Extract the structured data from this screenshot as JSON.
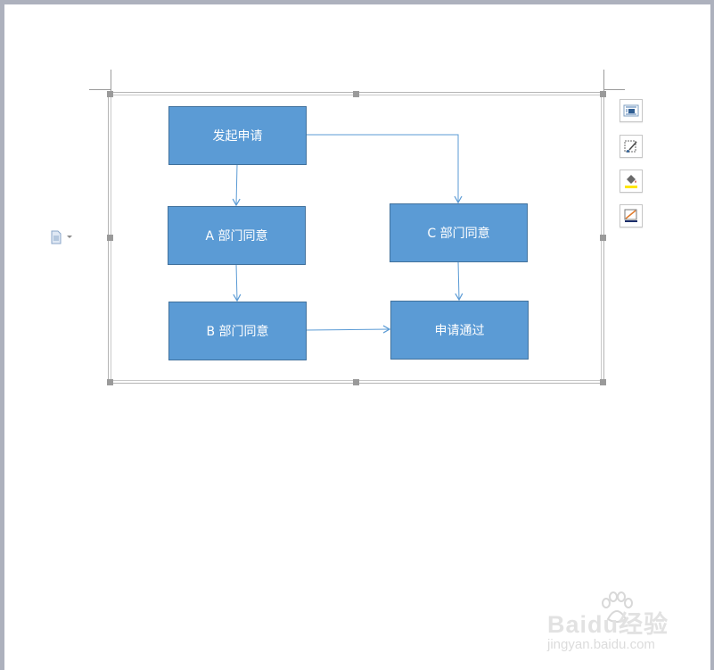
{
  "flowchart": {
    "nodes": {
      "start": "发起申请",
      "dept_a": "A 部门同意",
      "dept_b": "B 部门同意",
      "dept_c": "C 部门同意",
      "approved": "申请通过"
    },
    "colors": {
      "box_fill": "#5b9bd5",
      "box_border": "#41719c",
      "connector": "#5b9bd5",
      "text": "#ffffff"
    }
  },
  "side_toolbar": {
    "icons": [
      "layout-options-icon",
      "shape-outline-icon",
      "shape-fill-icon",
      "line-style-icon"
    ]
  },
  "paste_options": {
    "icon": "paste-options-icon"
  },
  "watermark": {
    "brand": "Baidu经验",
    "url": "jingyan.baidu.com"
  }
}
